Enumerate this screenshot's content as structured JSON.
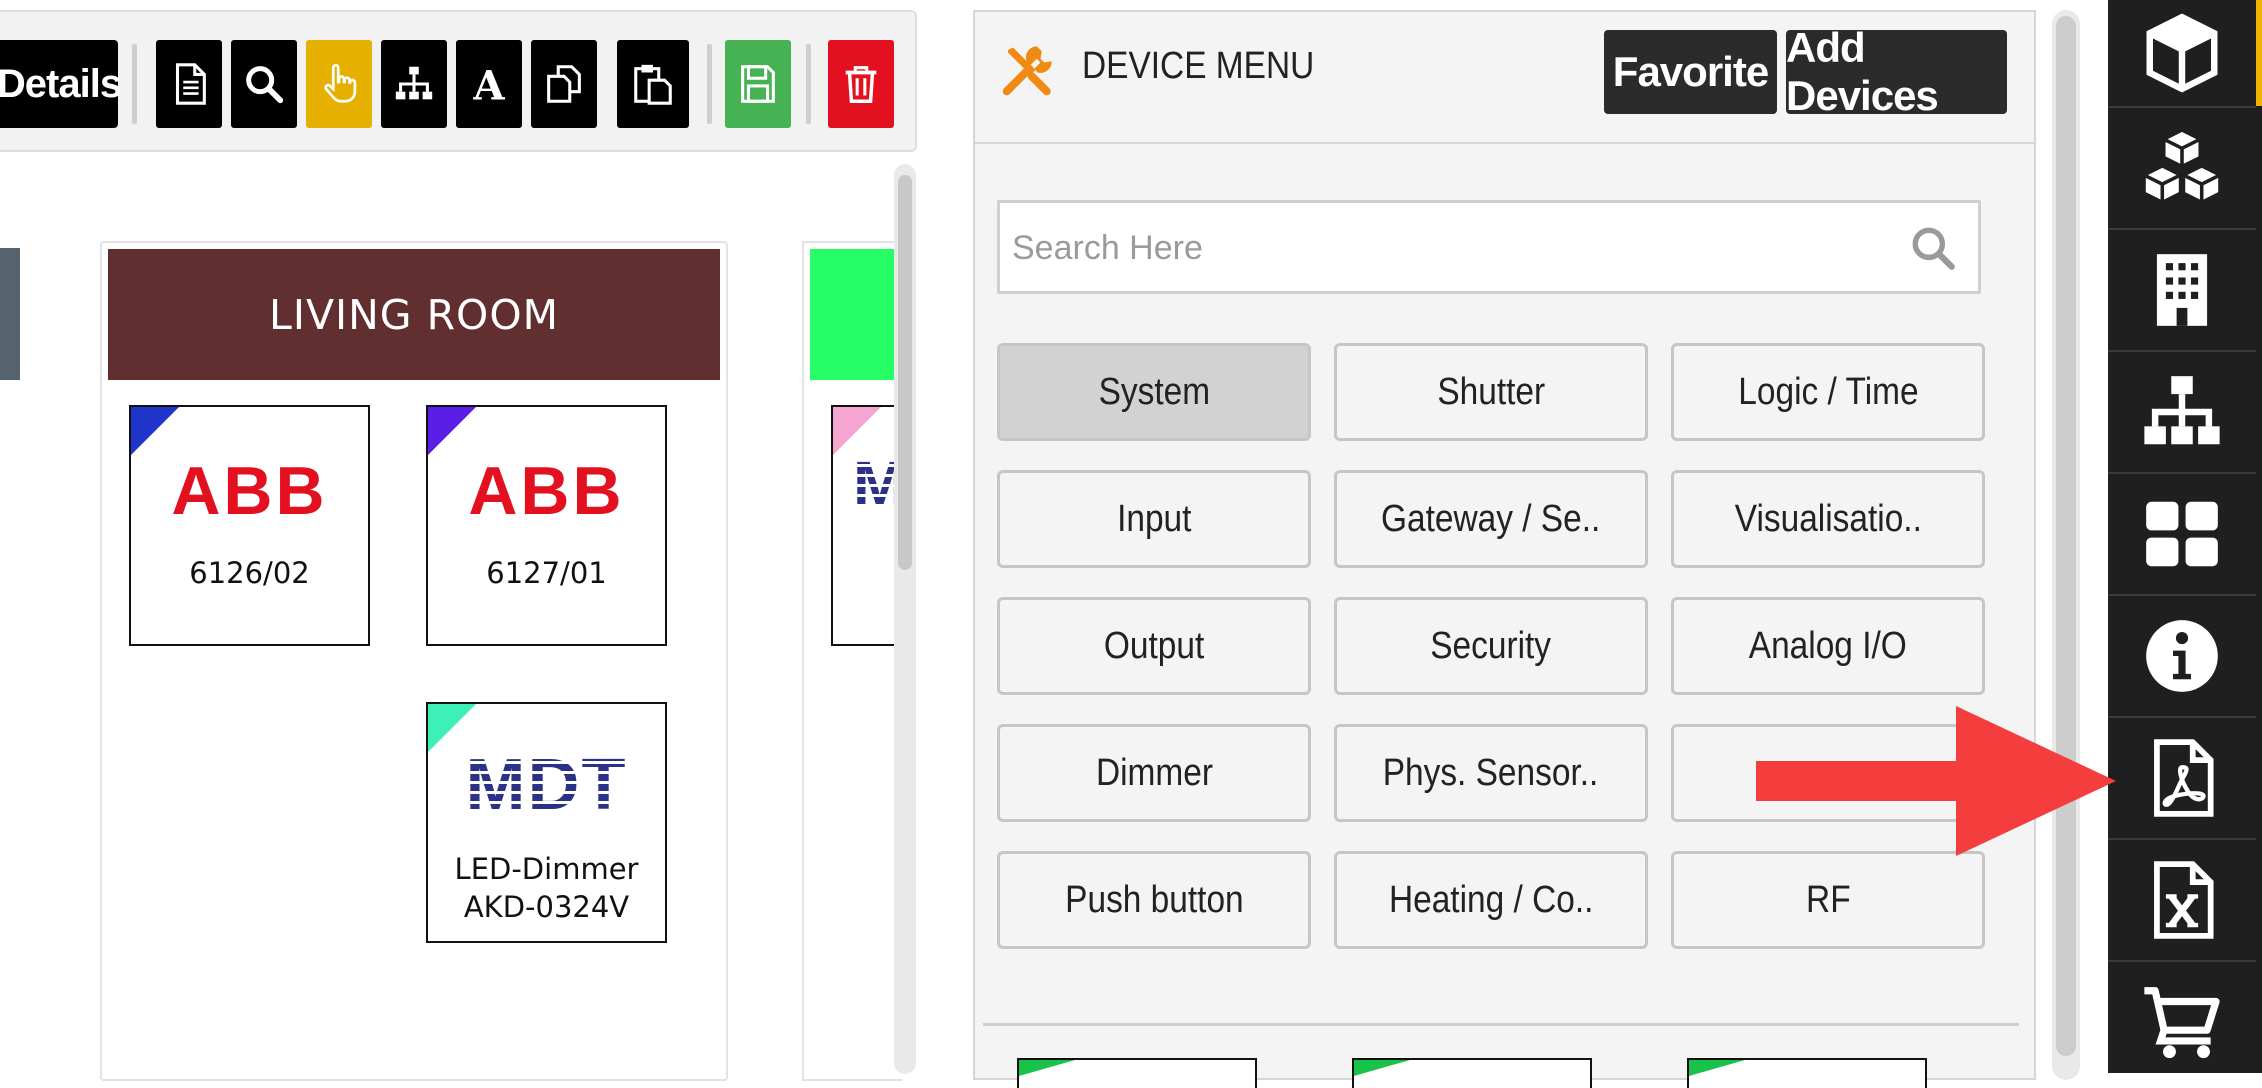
{
  "toolbar": {
    "details_label": "Details",
    "icons": [
      "document-icon",
      "search-icon",
      "hand-pointer-icon",
      "sitemap-icon",
      "text-icon",
      "copy-icon",
      "paste-icon",
      "save-icon",
      "trash-icon"
    ],
    "colors": {
      "default": "#000000",
      "active": "#e6b000",
      "save": "#46b254",
      "delete": "#e3101f"
    }
  },
  "rooms": [
    {
      "title": "LIVING ROOM",
      "color": "#622f30",
      "devices": [
        {
          "brand": "ABB",
          "label_lines": [
            "6126/02"
          ],
          "corner_color": "#1f35c9"
        },
        {
          "brand": "ABB",
          "label_lines": [
            "6127/01"
          ],
          "corner_color": "#5a1ee6"
        },
        {
          "brand": "MDT",
          "label_lines": [
            "LED-Dimmer",
            "AKD-0324V"
          ],
          "corner_color": "#3cf0b8"
        }
      ]
    },
    {
      "title": "",
      "color": "#25ff65",
      "devices": [
        {
          "brand": "MDT",
          "label_lines": [],
          "corner_color": "#f4a6d1"
        }
      ]
    }
  ],
  "device_menu": {
    "title": "DEVICE MENU",
    "favorite_label": "Favorite",
    "add_devices_label": "Add Devices",
    "search_placeholder": "Search Here",
    "categories": [
      {
        "label": "System",
        "active": true
      },
      {
        "label": "Shutter",
        "active": false
      },
      {
        "label": "Logic / Time",
        "active": false
      },
      {
        "label": "Input",
        "active": false
      },
      {
        "label": "Gateway / Se..",
        "active": false
      },
      {
        "label": "Visualisatio..",
        "active": false
      },
      {
        "label": "Output",
        "active": false
      },
      {
        "label": "Security",
        "active": false
      },
      {
        "label": "Analog I/O",
        "active": false
      },
      {
        "label": "Dimmer",
        "active": false
      },
      {
        "label": "Phys. Sensor..",
        "active": false
      },
      {
        "label": "",
        "active": false
      },
      {
        "label": "Push button",
        "active": false
      },
      {
        "label": "Heating / Co..",
        "active": false
      },
      {
        "label": "RF",
        "active": false
      }
    ]
  },
  "sidebar": {
    "items": [
      "cube-icon",
      "cubes-icon",
      "building-icon",
      "sitemap-icon",
      "grid-icon",
      "info-icon",
      "pdf-file-icon",
      "excel-file-icon",
      "cart-icon"
    ],
    "accent_color": "#f0b400"
  },
  "annotation": {
    "arrow_color": "#f43d3d"
  }
}
